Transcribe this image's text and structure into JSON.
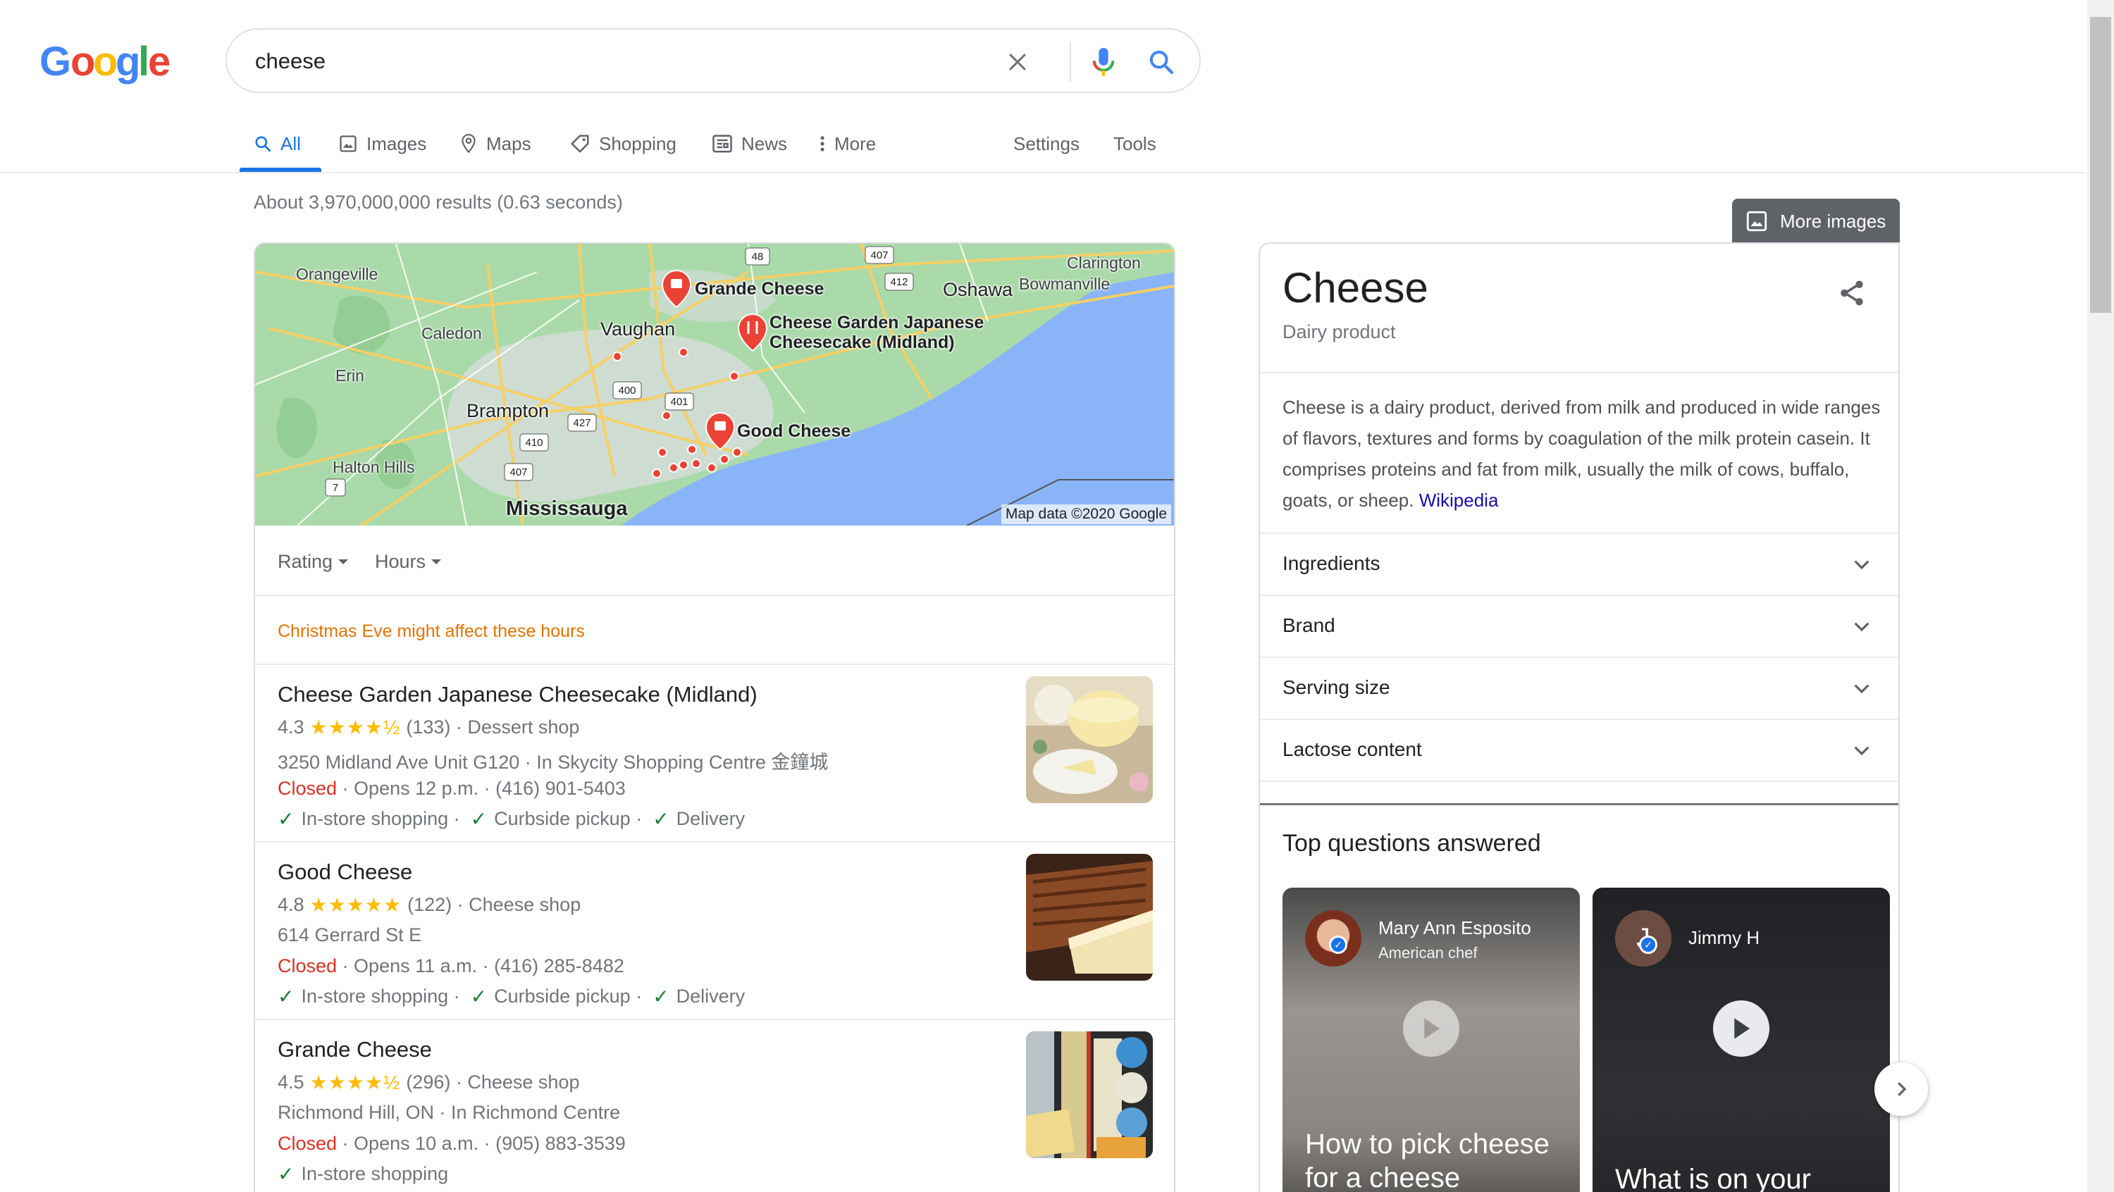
{
  "logo": {
    "text": "Google",
    "colors": [
      "#4285f4",
      "#ea4335",
      "#fbbc05",
      "#4285f4",
      "#34a853",
      "#ea4335"
    ]
  },
  "search": {
    "query": "cheese",
    "clear_icon": "close-icon",
    "voice_icon": "mic-icon",
    "search_icon": "search-icon"
  },
  "tabs": [
    {
      "label": "All",
      "icon": "search-icon",
      "active": true
    },
    {
      "label": "Images",
      "icon": "image-icon"
    },
    {
      "label": "Maps",
      "icon": "map-pin-icon"
    },
    {
      "label": "Shopping",
      "icon": "tag-icon"
    },
    {
      "label": "News",
      "icon": "newspaper-icon"
    },
    {
      "label": "More",
      "icon": "more-vert-icon"
    }
  ],
  "tools": {
    "settings": "Settings",
    "tools": "Tools"
  },
  "result_stats": "About 3,970,000,000 results (0.63 seconds)",
  "map": {
    "labels": {
      "orangeville": "Orangeville",
      "caledon": "Caledon",
      "erin": "Erin",
      "brampton": "Brampton",
      "halton_hills": "Halton Hills",
      "mississauga": "Mississauga",
      "vaughan": "Vaughan",
      "oshawa": "Oshawa",
      "clarington": "Clarington",
      "bowmanville": "Bowmanville"
    },
    "pins": {
      "grande": "Grande Cheese",
      "garden": "Cheese Garden Japanese Cheesecake (Midland)",
      "good": "Good Cheese"
    },
    "highways": [
      "48",
      "407",
      "412",
      "400",
      "401",
      "427",
      "410",
      "407",
      "7"
    ],
    "attribution": "Map data ©2020 Google"
  },
  "filters": {
    "rating": "Rating",
    "hours": "Hours"
  },
  "holiday_note": "Christmas Eve might affect these hours",
  "businesses": [
    {
      "name": "Cheese Garden Japanese Cheesecake (Midland)",
      "rating": "4.3",
      "rating_value": 4.3,
      "stars": "★★★★½",
      "reviews": "(133)",
      "category": "Dessert shop",
      "address": "3250 Midland Ave Unit G120 · In Skycity Shopping Centre 金鐘城",
      "status": "Closed",
      "hours": "Opens 12 p.m. · (416) 901-5403",
      "services": [
        "In-store shopping",
        "Curbside pickup",
        "Delivery"
      ]
    },
    {
      "name": "Good Cheese",
      "rating": "4.8",
      "rating_value": 4.8,
      "stars": "★★★★★",
      "reviews": "(122)",
      "category": "Cheese shop",
      "address": "614 Gerrard St E",
      "status": "Closed",
      "hours": "Opens 11 a.m. · (416) 285-8482",
      "services": [
        "In-store shopping",
        "Curbside pickup",
        "Delivery"
      ]
    },
    {
      "name": "Grande Cheese",
      "rating": "4.5",
      "rating_value": 4.5,
      "stars": "★★★★½",
      "reviews": "(296)",
      "category": "Cheese shop",
      "address": "Richmond Hill, ON · In Richmond Centre",
      "status": "Closed",
      "hours": "Opens 10 a.m. · (905) 883-3539",
      "services": [
        "In-store shopping"
      ]
    }
  ],
  "knowledge_panel": {
    "more_images": "More images",
    "title": "Cheese",
    "subtitle": "Dairy product",
    "description": "Cheese is a dairy product, derived from milk and produced in wide ranges of flavors, textures and forms by coagulation of the milk protein casein. It comprises proteins and fat from milk, usually the milk of cows, buffalo, goats, or sheep.",
    "source_link": "Wikipedia",
    "accordion": [
      "Ingredients",
      "Brand",
      "Serving size",
      "Lactose content"
    ],
    "top_questions_heading": "Top questions answered",
    "videos": [
      {
        "name": "Mary Ann Esposito",
        "role": "American chef",
        "question": "How to pick cheese for a cheese"
      },
      {
        "name": "Jimmy H",
        "initial": "J",
        "question": "What is on your"
      }
    ]
  }
}
